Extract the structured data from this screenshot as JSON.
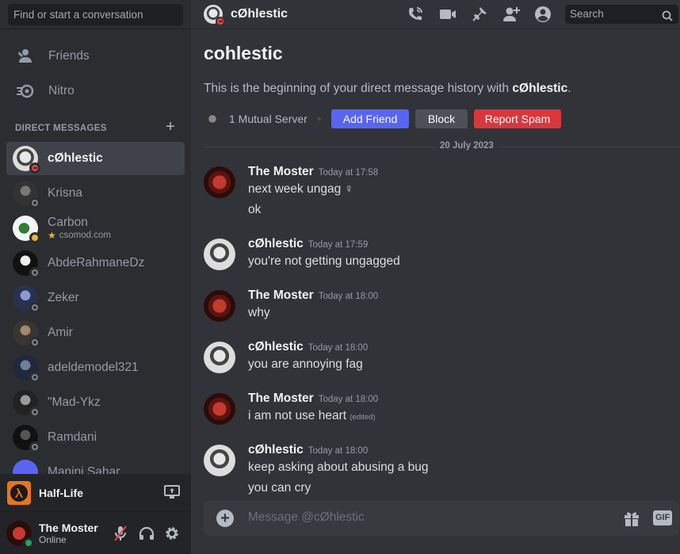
{
  "sidebar": {
    "search_placeholder": "Find or start a conversation",
    "nav": {
      "friends": "Friends",
      "nitro": "Nitro"
    },
    "dm_header": "DIRECT MESSAGES",
    "dm_add": "+",
    "dms": [
      {
        "name": "cØhlestic",
        "status": "dnd",
        "active": true
      },
      {
        "name": "Krisna",
        "status": "offline"
      },
      {
        "name": "Carbon",
        "status": "idle",
        "sub": "csomod.com"
      },
      {
        "name": "AbdeRahmaneDz",
        "status": "offline"
      },
      {
        "name": "Zeker",
        "status": "offline"
      },
      {
        "name": "Amir",
        "status": "offline"
      },
      {
        "name": "adeldemodel321",
        "status": "offline"
      },
      {
        "name": "\"Mad-Ykz",
        "status": "offline"
      },
      {
        "name": "Ramdani",
        "status": "offline"
      },
      {
        "name": "Manini Sahar",
        "status": "offline"
      }
    ],
    "activity": {
      "game": "Half-Life"
    },
    "user": {
      "name": "The Moster",
      "status": "Online"
    }
  },
  "topbar": {
    "name": "cØhlestic",
    "search_placeholder": "Search"
  },
  "welcome": {
    "title": "cohlestic",
    "sub_prefix": "This is the beginning of your direct message history with ",
    "sub_name": "cØhlestic",
    "sub_suffix": ".",
    "mutual": "1 Mutual Server",
    "add_friend": "Add Friend",
    "block": "Block",
    "report_spam": "Report Spam"
  },
  "date_divider": "20 July 2023",
  "messages": [
    {
      "author": "The Moster",
      "time": "Today at 17:58",
      "lines": [
        "next week ungag ♀",
        "ok"
      ]
    },
    {
      "author": "cØhlestic",
      "time": "Today at 17:59",
      "lines": [
        "you're not getting ungagged"
      ]
    },
    {
      "author": "The Moster",
      "time": "Today at 18:00",
      "lines": [
        "why"
      ]
    },
    {
      "author": "cØhlestic",
      "time": "Today at 18:00",
      "lines": [
        "you are annoying fag"
      ]
    },
    {
      "author": "The Moster",
      "time": "Today at 18:00",
      "lines": [
        "i am not use heart"
      ],
      "edited": "(edited)"
    },
    {
      "author": "cØhlestic",
      "time": "Today at 18:00",
      "lines": [
        "keep asking about abusing a bug",
        "you can cry"
      ]
    }
  ],
  "composer": {
    "placeholder": "Message @cØhlestic",
    "gif": "GIF"
  },
  "colors": {
    "blurple": "#5865f2",
    "red": "#da373c",
    "grey": "#4e5058",
    "bg": "#313338",
    "sidebar": "#2b2d31"
  }
}
